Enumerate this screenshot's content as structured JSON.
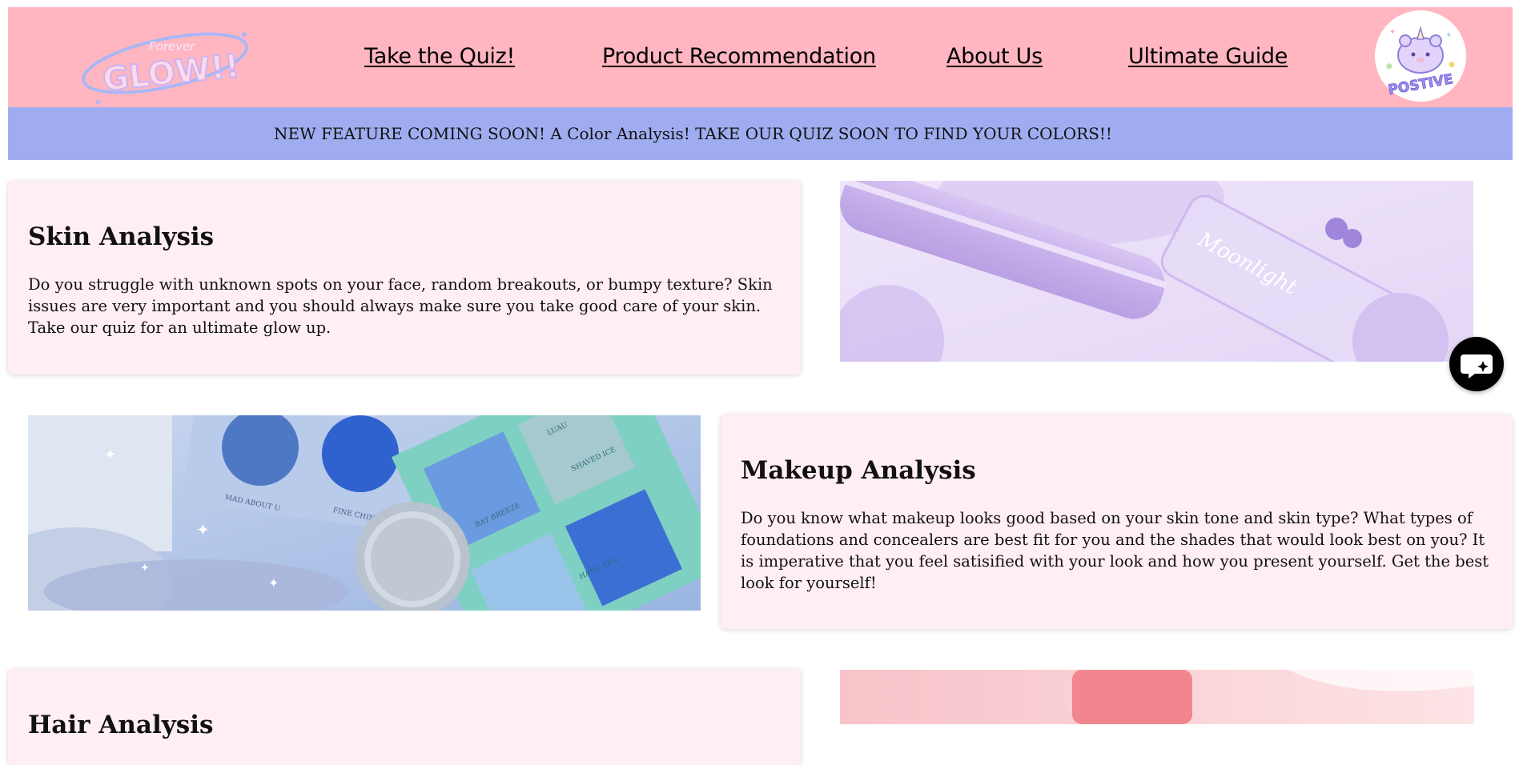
{
  "header": {
    "logo_text": "GLOW!!",
    "logo_small_text": "Forever",
    "nav": [
      {
        "label": "Take the Quiz!"
      },
      {
        "label": "Product Recommendation"
      },
      {
        "label": "About Us"
      },
      {
        "label": "Ultimate Guide"
      }
    ],
    "badge_text": "POSTIVE",
    "colors": {
      "header_bg": "#ffb6c1",
      "banner_bg": "#9fadf0",
      "card_bg": "#ffeef3"
    }
  },
  "banner": {
    "text": "NEW FEATURE COMING SOON! A Color Analysis! TAKE OUR QUIZ SOON TO FIND YOUR COLORS!!"
  },
  "sections": [
    {
      "title": "Skin Analysis",
      "body": "Do you struggle with unknown spots on your face, random breakouts, or bumpy texture? Skin issues are very important and you should always make sure you take good care of your skin. Take our quiz for an ultimate glow up.",
      "image": "lavender-cosmetics-photo"
    },
    {
      "title": "Makeup Analysis",
      "body": "Do you know what makeup looks good based on your skin tone and skin type? What types of foundations and concealers are best fit for you and the shades that would look best on you? It is imperative that you feel satisified with your look and how you present yourself. Get the best look for yourself!",
      "image": "blue-eyeshadow-palette-photo",
      "image_labels": [
        "MAD ABOUT U",
        "FINE CHINA",
        "LUAU",
        "SHAVED ICE",
        "BAY BREEZE",
        "HANG TEN"
      ]
    },
    {
      "title": "Hair Analysis",
      "image": "pink-product-photo"
    }
  ],
  "chat_button": {
    "icon": "chat-bubble-sparkle-icon"
  }
}
